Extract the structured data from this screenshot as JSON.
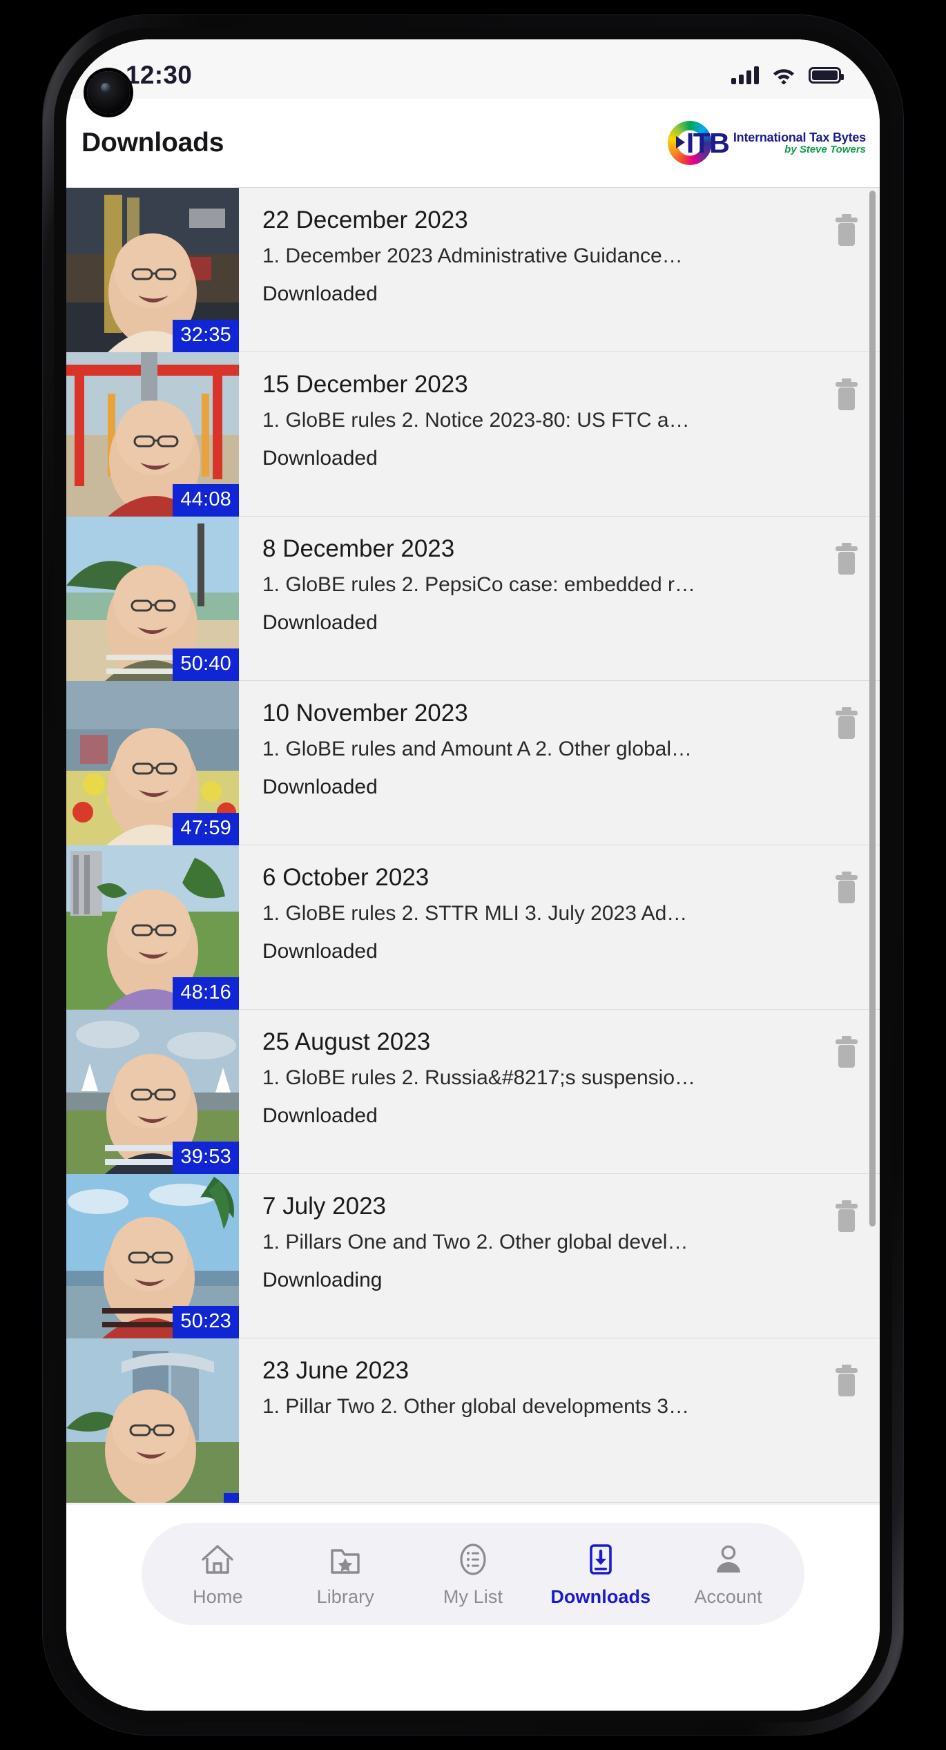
{
  "device": {
    "status_bar": {
      "time": "12:30",
      "signal_icon": "cellular-signal-icon",
      "wifi_icon": "wifi-icon",
      "battery_icon": "battery-full-icon"
    }
  },
  "header": {
    "title": "Downloads",
    "logo": {
      "mark": "ITB",
      "line1": "International Tax Bytes",
      "line2": "by Steve Towers"
    }
  },
  "colors": {
    "accent": "#1a1ad0",
    "duration_badge": "#1026d4",
    "list_bg": "#f2f2f2",
    "tabbar_bg": "#f2f2f6",
    "inactive_text": "#8b8b90"
  },
  "downloads": {
    "items": [
      {
        "date": "22 December 2023",
        "description": "1. December 2023 Administrative Guidance…",
        "status": "Downloaded",
        "duration": "32:35"
      },
      {
        "date": "15 December 2023",
        "description": "1. GloBE rules 2. Notice 2023-80: US FTC a…",
        "status": "Downloaded",
        "duration": "44:08"
      },
      {
        "date": "8 December 2023",
        "description": "1. GloBE rules 2. PepsiCo case: embedded r…",
        "status": "Downloaded",
        "duration": "50:40"
      },
      {
        "date": "10 November 2023",
        "description": "1. GloBE rules and Amount A 2. Other global…",
        "status": "Downloaded",
        "duration": "47:59"
      },
      {
        "date": "6 October 2023",
        "description": "1. GloBE rules 2. STTR MLI 3. July 2023 Ad…",
        "status": "Downloaded",
        "duration": "48:16"
      },
      {
        "date": "25 August 2023",
        "description": "1. GloBE rules 2. Russia&#8217;s suspensio…",
        "status": "Downloaded",
        "duration": "39:53"
      },
      {
        "date": "7 July 2023",
        "description": "1. Pillars One and Two 2. Other global devel…",
        "status": "Downloading",
        "duration": "50:23"
      },
      {
        "date": "23 June 2023",
        "description": "1. Pillar Two 2. Other global developments 3…",
        "status": "",
        "duration": ""
      }
    ],
    "delete_icon": "trash-icon"
  },
  "tabbar": {
    "tabs": [
      {
        "label": "Home",
        "icon": "home-icon",
        "active": false
      },
      {
        "label": "Library",
        "icon": "folder-star-icon",
        "active": false
      },
      {
        "label": "My List",
        "icon": "list-icon",
        "active": false
      },
      {
        "label": "Downloads",
        "icon": "download-icon",
        "active": true
      },
      {
        "label": "Account",
        "icon": "person-icon",
        "active": false
      }
    ]
  }
}
